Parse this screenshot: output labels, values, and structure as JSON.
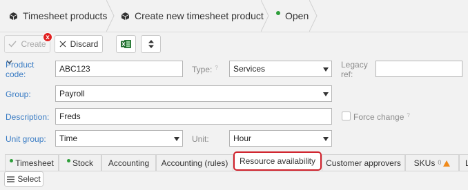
{
  "breadcrumb": {
    "items": [
      {
        "label": "Timesheet products",
        "icon": "cube-icon"
      },
      {
        "label": "Create new timesheet product",
        "icon": "cube-icon"
      },
      {
        "label": "Open",
        "icon": "status-dot",
        "dot_color": "#2e9e3a"
      }
    ]
  },
  "toolbar": {
    "create_label": "Create",
    "create_error_badge": "x",
    "discard_label": "Discard",
    "excel_icon": "excel-icon",
    "sort_icon": "sort-arrows-icon"
  },
  "form": {
    "product_code_label": "Product code:",
    "product_code_value": "ABC123",
    "type_label": "Type:",
    "type_value": "Services",
    "legacy_ref_label": "Legacy ref:",
    "legacy_ref_value": "",
    "group_label": "Group:",
    "group_value": "Payroll",
    "description_label": "Description:",
    "description_value": "Freds",
    "force_change_label": "Force change",
    "force_change_checked": false,
    "unit_group_label": "Unit group:",
    "unit_group_value": "Time",
    "unit_label": "Unit:",
    "unit_value": "Hour",
    "help_marker": "?"
  },
  "tabs": [
    {
      "label": "Timesheet",
      "dot": true
    },
    {
      "label": "Stock",
      "dot": true
    },
    {
      "label": "Accounting"
    },
    {
      "label": "Accounting (rules)"
    },
    {
      "label": "Resource availability",
      "active": true
    },
    {
      "label": "Customer approvers"
    },
    {
      "label": "SKUs",
      "badge": "0"
    },
    {
      "label": "L"
    }
  ],
  "bottom": {
    "select_label": "Select"
  },
  "colors": {
    "accent_blue": "#3a7cc4",
    "active_tab_border": "#d0202a",
    "status_green": "#2e9e3a",
    "error_red": "#e02020",
    "warning_orange": "#f08a1a"
  }
}
